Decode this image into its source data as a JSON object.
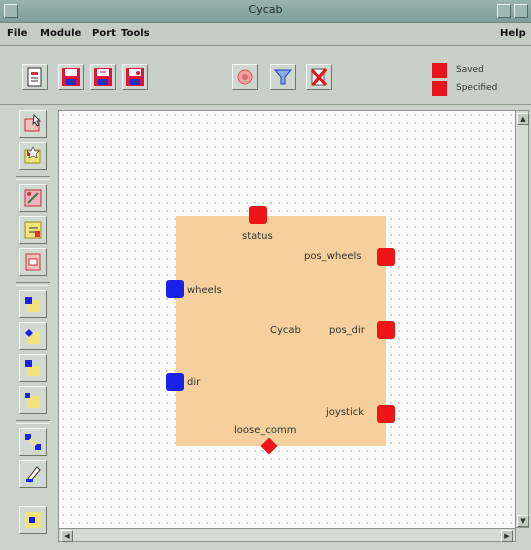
{
  "window": {
    "title": "Cycab"
  },
  "menu": {
    "file": "File",
    "module": "Module",
    "port": "Port",
    "tools": "Tools",
    "help": "Help"
  },
  "legend": {
    "saved": "Saved",
    "specified": "Specified",
    "color": "#e8141c"
  },
  "module": {
    "name": "Cycab",
    "ports": {
      "status": "status",
      "pos_wheels": "pos_wheels",
      "wheels": "wheels",
      "pos_dir": "pos_dir",
      "dir": "dir",
      "joystick": "joystick",
      "loose_comm": "loose_comm"
    },
    "colors": {
      "body": "#f5cf9c",
      "output_port": "#ee1418",
      "input_port": "#1a22e8"
    }
  },
  "icons": {
    "toolbar": [
      "document-icon",
      "save-icon",
      "save-as-icon",
      "save-all-icon",
      "target-icon",
      "filter-icon",
      "delete-icon"
    ],
    "sidebar": [
      "pointer-module-icon",
      "new-module-icon",
      "link-module-icon",
      "rename-module-icon",
      "copy-module-icon",
      "add-input-port-icon",
      "add-output-port-icon",
      "add-input-output-port-icon",
      "add-event-port-icon",
      "connect-ports-icon",
      "pencil-icon",
      "port-properties-icon"
    ]
  }
}
